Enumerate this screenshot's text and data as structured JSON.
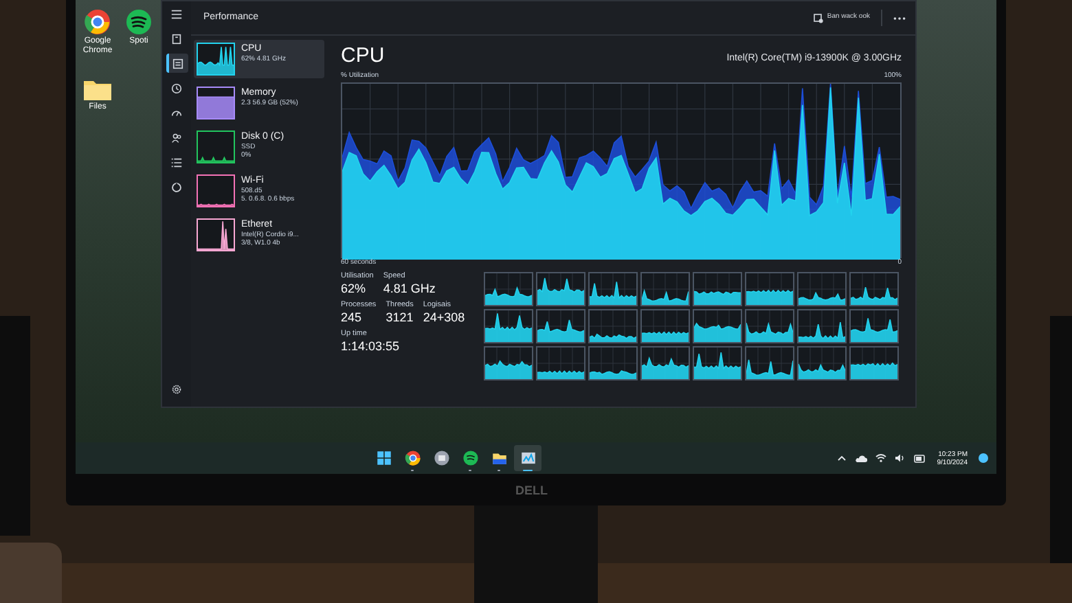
{
  "desktop_icons": [
    {
      "label": "Google Chrome"
    },
    {
      "label": "Spoti"
    },
    {
      "label": "Files"
    }
  ],
  "task_manager": {
    "title": "Performance",
    "run_task": "Ban wack ook",
    "nav_rail": [
      {
        "selected": false
      },
      {
        "selected": false
      },
      {
        "selected": true
      },
      {
        "selected": false
      },
      {
        "selected": false
      },
      {
        "selected": false
      },
      {
        "selected": false
      },
      {
        "selected": false
      },
      {
        "selected": false
      }
    ],
    "resources": [
      {
        "name": "CPU",
        "lines": [
          "62% 4.81 GHz"
        ],
        "selected": true,
        "color": "#22d3ee"
      },
      {
        "name": "Memory",
        "lines": [
          "2.3 56.9 GB (52%)"
        ],
        "selected": false,
        "color": "#a78bfa"
      },
      {
        "name": "Disk 0 (C)",
        "lines": [
          "SSD",
          "0%"
        ],
        "selected": false,
        "color": "#22c55e"
      },
      {
        "name": "Wi-Fi",
        "lines": [
          "508.d5",
          "5. 0.6.8. 0.6 bbps"
        ],
        "selected": false,
        "color": "#f472b6"
      },
      {
        "name": "Etheret",
        "lines": [
          "Intel(R) Cordio i9...",
          "3/8, W1.0 4b"
        ],
        "selected": false,
        "color": "#f9a8d4"
      }
    ],
    "cpu": {
      "heading": "CPU",
      "model": "Intel(R) Core(TM) i9-13900K @ 3.00GHz",
      "y_label": "% Utilization",
      "y_max": "100%",
      "x_label": "60 seconds",
      "x_min": "0",
      "stats_rows": [
        [
          {
            "label": "Utilisation",
            "value": "62%"
          },
          {
            "label": "Speed",
            "value": "4.81 GHz"
          }
        ],
        [
          {
            "label": "Processes",
            "value": "245"
          },
          {
            "label": "Threeds",
            "value": "3121"
          },
          {
            "label": "Logisais",
            "value": "24+308"
          }
        ],
        [
          {
            "label": "Up time",
            "value": "1:14:03:55"
          }
        ]
      ]
    }
  },
  "taskbar": {
    "apps": [
      {
        "running": false,
        "selected": false
      },
      {
        "running": true,
        "selected": false
      },
      {
        "running": false,
        "selected": false
      },
      {
        "running": true,
        "selected": false
      },
      {
        "running": true,
        "selected": false
      },
      {
        "running": true,
        "selected": true
      }
    ],
    "clock_time": "10:23 PM",
    "clock_date": "9/10/2024"
  },
  "monitor_brand": "DELL"
}
